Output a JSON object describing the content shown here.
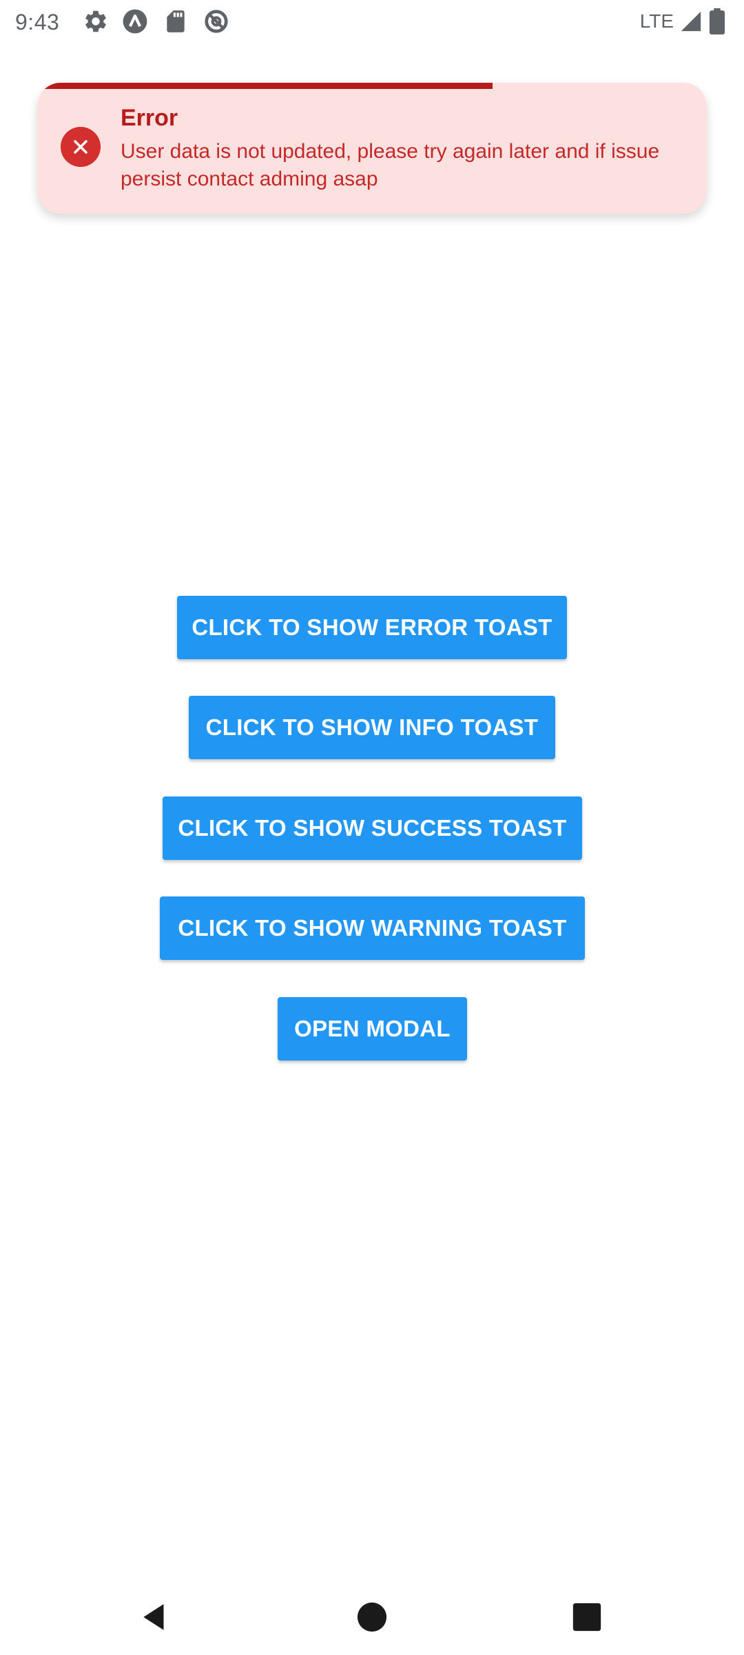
{
  "status_bar": {
    "time": "9:43",
    "network": "LTE",
    "icons": [
      "settings-icon",
      "app-notification-icon",
      "sd-card-icon",
      "data-saver-icon",
      "signal-icon",
      "battery-icon"
    ]
  },
  "toast": {
    "type": "error",
    "title": "Error",
    "message": "User data is not updated, please try again later and if issue persist contact adming asap",
    "progress_fraction": 0.68,
    "colors": {
      "background": "#fde1e1",
      "title": "#b71c1c",
      "icon": "#d32f2f",
      "progress": "#b71c1c"
    }
  },
  "buttons": {
    "error_toast": "CLICK TO SHOW ERROR TOAST",
    "info_toast": "CLICK TO SHOW INFO TOAST",
    "success_toast": "CLICK TO SHOW SUCCESS TOAST",
    "warning_toast": "CLICK TO SHOW WARNING TOAST",
    "open_modal": "OPEN MODAL"
  },
  "colors": {
    "button": "#2196f3"
  },
  "nav_bar": {
    "icons": [
      "back-icon",
      "home-icon",
      "recents-icon"
    ]
  }
}
